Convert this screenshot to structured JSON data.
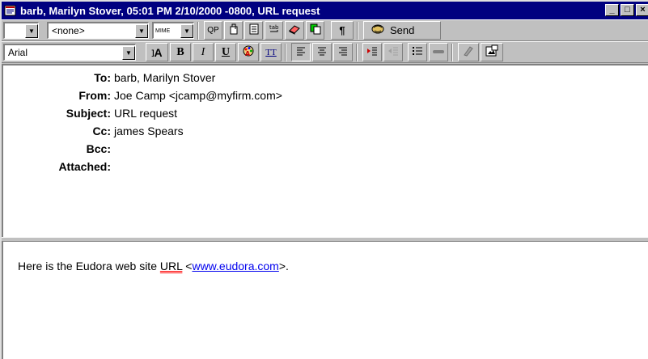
{
  "window": {
    "title": "barb, Marilyn Stover, 05:01 PM 2/10/2000 -0800, URL request",
    "controls": [
      "_",
      "□",
      "×"
    ]
  },
  "toolbar1": {
    "priority_value": "",
    "signature_value": "<none>",
    "encoding_label": "MIME",
    "qp_label": "QP",
    "send_label": "Send",
    "paragraph_glyph": "¶"
  },
  "toolbar2": {
    "font_value": "Arial",
    "size_label": "A",
    "bold_label": "B",
    "italic_label": "I",
    "underline_label": "U",
    "teletype_label": "TT"
  },
  "headers": {
    "to_label": "To:",
    "to_value": "barb, Marilyn Stover",
    "from_label": "From:",
    "from_value": "Joe Camp <jcamp@myfirm.com>",
    "subject_label": "Subject:",
    "subject_value": "URL request",
    "cc_label": "Cc:",
    "cc_value": "james Spears",
    "bcc_label": "Bcc:",
    "bcc_value": "",
    "attached_label": "Attached:",
    "attached_value": ""
  },
  "message": {
    "text_before": "Here is the Eudora web site ",
    "misspelled_word": "URL",
    "text_middle": " <",
    "link_text": "www.eudora.com",
    "text_after": ">."
  },
  "colors": {
    "titlebar": "#000080",
    "chrome": "#c0c0c0",
    "link": "#0000ee",
    "spell_underline": "#ff0000"
  }
}
